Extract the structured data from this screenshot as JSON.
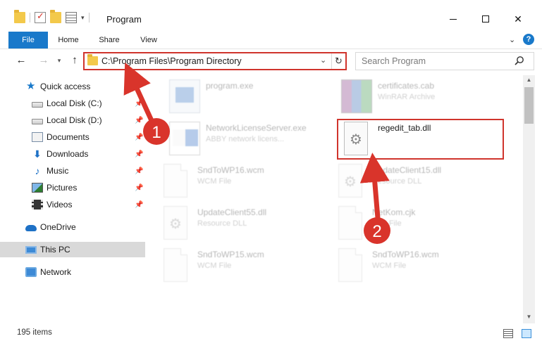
{
  "window": {
    "title": "Program"
  },
  "ribbon": {
    "tabs": [
      "File",
      "Home",
      "Share",
      "View"
    ]
  },
  "address": {
    "path": "C:\\Program Files\\Program Directory"
  },
  "search": {
    "placeholder": "Search Program"
  },
  "sidebar": {
    "items": [
      {
        "label": "Quick access",
        "icon": "star-icon"
      },
      {
        "label": "Local Disk (C:)",
        "icon": "drive-icon",
        "pinned": true
      },
      {
        "label": "Local Disk (D:)",
        "icon": "drive-icon",
        "pinned": true
      },
      {
        "label": "Documents",
        "icon": "documents-icon",
        "pinned": true
      },
      {
        "label": "Downloads",
        "icon": "download-icon",
        "pinned": true
      },
      {
        "label": "Music",
        "icon": "music-icon",
        "pinned": true
      },
      {
        "label": "Pictures",
        "icon": "pictures-icon",
        "pinned": true
      },
      {
        "label": "Videos",
        "icon": "videos-icon",
        "pinned": true
      },
      {
        "label": "OneDrive",
        "icon": "cloud-icon"
      },
      {
        "label": "This PC",
        "icon": "computer-icon",
        "selected": true
      },
      {
        "label": "Network",
        "icon": "network-icon"
      }
    ]
  },
  "files": [
    {
      "name": "program.exe",
      "type": "",
      "faded": true
    },
    {
      "name": "certificates.cab",
      "type": "WinRAR Archive",
      "faded": true
    },
    {
      "name": "NetworkLicenseServer.exe",
      "type": "ABBY network licens...",
      "faded": true
    },
    {
      "name": "regedit_tab.dll",
      "type": "",
      "faded": false,
      "highlighted": true
    },
    {
      "name": "SndToWP16.wcm",
      "type": "WCM File",
      "faded": true
    },
    {
      "name": "UpdateClient15.dll",
      "type": "Resource DLL",
      "faded": true
    },
    {
      "name": "UpdateClient55.dll",
      "type": "Resource DLL",
      "faded": true
    },
    {
      "name": "NetKom.cjk",
      "type": "CJK File",
      "faded": true
    },
    {
      "name": "SndToWP15.wcm",
      "type": "WCM File",
      "faded": true
    },
    {
      "name": "SndToWP16.wcm",
      "type": "WCM File",
      "faded": true
    }
  ],
  "status": {
    "count": "195 items"
  },
  "annotations": {
    "badge1": "1",
    "badge2": "2",
    "color": "#d9342b"
  }
}
